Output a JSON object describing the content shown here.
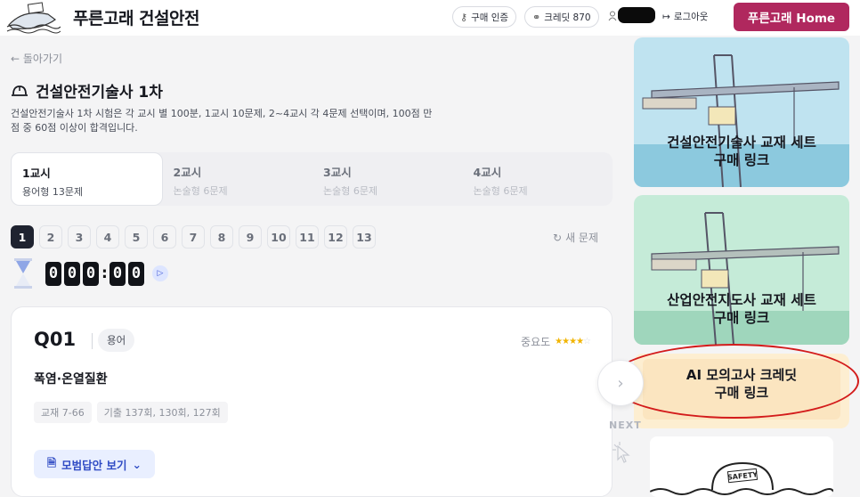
{
  "header": {
    "brand": "푸른고래 건설안전",
    "purchase_verify": "구매 인증",
    "credit": "크레딧 870",
    "logout": "로그아웃",
    "home_button": "푸른고래 Home"
  },
  "main": {
    "back": "← 돌아가기",
    "exam_title": "건설안전기술사 1차",
    "exam_desc": "건설안전기술사 1차 시험은 각 교시 별 100분, 1교시 10문제, 2~4교시 각 4문제 선택이며, 100점 만점 중 60점 이상이 합격입니다.",
    "tabs": [
      {
        "title": "1교시",
        "sub": "용어형 13문제"
      },
      {
        "title": "2교시",
        "sub": "논술형 6문제"
      },
      {
        "title": "3교시",
        "sub": "논술형 6문제"
      },
      {
        "title": "4교시",
        "sub": "논술형 6문제"
      }
    ],
    "question_numbers": [
      "1",
      "2",
      "3",
      "4",
      "5",
      "6",
      "7",
      "8",
      "9",
      "10",
      "11",
      "12",
      "13"
    ],
    "new_question": "새 문제",
    "timer_digits": [
      "0",
      "0",
      "0",
      "0",
      "0"
    ]
  },
  "question": {
    "id": "Q01",
    "type": "용어",
    "importance_label": "중요도",
    "importance_stars": 4,
    "importance_max": 5,
    "topic": "폭염·온열질환",
    "tags": [
      "교재 7-66",
      "기출 137회, 130회, 127회"
    ],
    "answer_button": "모범답안 보기"
  },
  "sidebar": {
    "ad1_line1": "건설안전기술사 교재 세트",
    "ad1_line2": "구매 링크",
    "ad2_line1": "산업안전지도사 교재 세트",
    "ad2_line2": "구매 링크",
    "ad3_line1": "AI 모의고사 크레딧",
    "ad3_line2": "구매 링크",
    "next_label": "NEXT",
    "ad4_badge": "SAFETY"
  },
  "colors": {
    "brand_button": "#b0285e",
    "accent_blue": "#2f4bc4",
    "star": "#f1b400",
    "annotation_red": "#d31b1b"
  }
}
